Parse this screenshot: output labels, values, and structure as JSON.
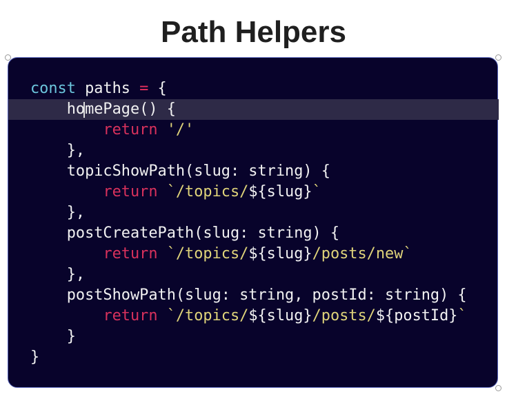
{
  "title": "Path Helpers",
  "colors": {
    "background": "#08032b",
    "keyword": "#6cc6dd",
    "operator": "#e8305f",
    "return": "#d8315c",
    "string": "#e0d47a",
    "text": "#f2f2f2",
    "active_line": "#2e2a47"
  },
  "code": {
    "active_line": 1,
    "lines": [
      [
        [
          "kw",
          "const"
        ],
        [
          "pl",
          " paths "
        ],
        [
          "op",
          "="
        ],
        [
          "pl",
          " {"
        ]
      ],
      [
        [
          "pl",
          "    homePage() {"
        ]
      ],
      [
        [
          "pl",
          "        "
        ],
        [
          "ret",
          "return"
        ],
        [
          "pl",
          " "
        ],
        [
          "str",
          "'/'"
        ]
      ],
      [
        [
          "pl",
          "    },"
        ]
      ],
      [
        [
          "pl",
          "    topicShowPath(slug: string) {"
        ]
      ],
      [
        [
          "pl",
          "        "
        ],
        [
          "ret",
          "return"
        ],
        [
          "pl",
          " "
        ],
        [
          "str",
          "`/topics/"
        ],
        [
          "pl",
          "${slug}"
        ],
        [
          "str",
          "`"
        ]
      ],
      [
        [
          "pl",
          "    },"
        ]
      ],
      [
        [
          "pl",
          "    postCreatePath(slug: string) {"
        ]
      ],
      [
        [
          "pl",
          "        "
        ],
        [
          "ret",
          "return"
        ],
        [
          "pl",
          " "
        ],
        [
          "str",
          "`/topics/"
        ],
        [
          "pl",
          "${slug}"
        ],
        [
          "str",
          "/posts/new`"
        ]
      ],
      [
        [
          "pl",
          "    },"
        ]
      ],
      [
        [
          "pl",
          "    postShowPath(slug: string, postId: string) {"
        ]
      ],
      [
        [
          "pl",
          "        "
        ],
        [
          "ret",
          "return"
        ],
        [
          "pl",
          " "
        ],
        [
          "str",
          "`/topics/"
        ],
        [
          "pl",
          "${slug}"
        ],
        [
          "str",
          "/posts/"
        ],
        [
          "pl",
          "${postId}"
        ],
        [
          "str",
          "`"
        ]
      ],
      [
        [
          "pl",
          "    }"
        ]
      ],
      [
        [
          "pl",
          "}"
        ]
      ]
    ]
  }
}
